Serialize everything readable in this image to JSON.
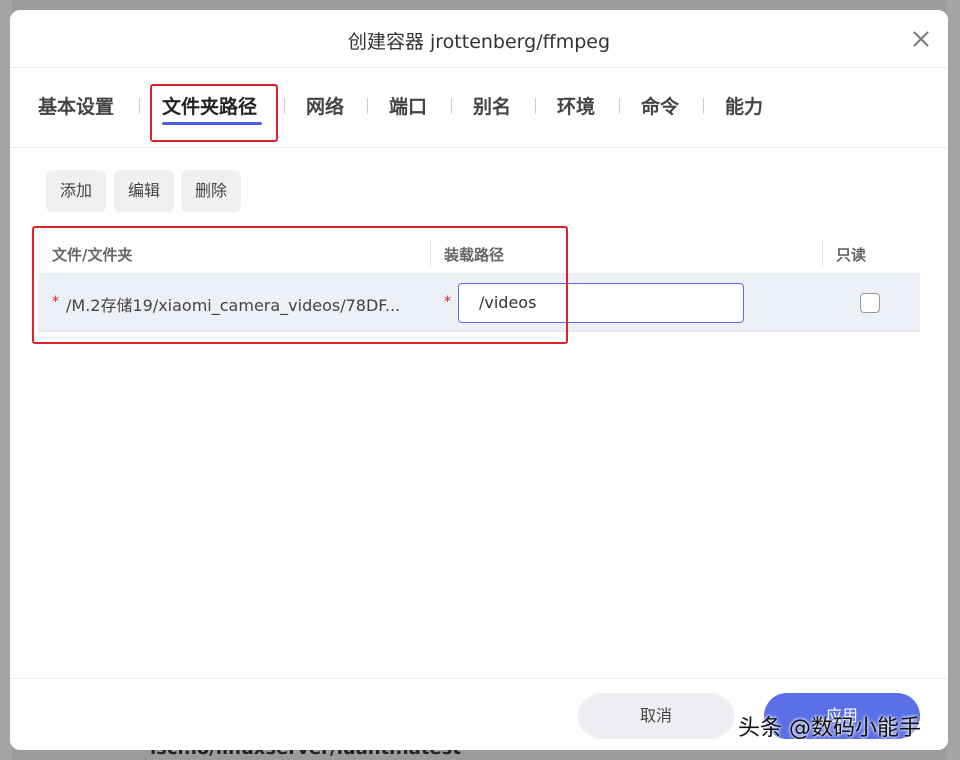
{
  "dialog": {
    "title": "创建容器 jrottenberg/ffmpeg"
  },
  "tabs": [
    {
      "label": "基本设置"
    },
    {
      "label": "文件夹路径",
      "active": true
    },
    {
      "label": "网络"
    },
    {
      "label": "端口"
    },
    {
      "label": "别名"
    },
    {
      "label": "环境"
    },
    {
      "label": "命令"
    },
    {
      "label": "能力"
    }
  ],
  "toolbar": {
    "add_label": "添加",
    "edit_label": "编辑",
    "delete_label": "删除"
  },
  "table": {
    "columns": [
      "文件/文件夹",
      "装载路径",
      "只读"
    ],
    "rows": [
      {
        "path": "/M.2存储19/xiaomi_camera_videos/78DF...",
        "mount": "/videos",
        "readonly": false
      }
    ]
  },
  "footer": {
    "cancel_label": "取消",
    "apply_label": "应用"
  },
  "watermark": "头条 @数码小能手",
  "background": {
    "bottom_text": "lscr.io/linuxserver/luanti:latest"
  },
  "colors": {
    "accent": "#5b6fe6",
    "highlight": "#e0202a",
    "required": "#e0202a"
  },
  "icons": {
    "close": "close-icon",
    "checkbox": "checkbox-unchecked"
  }
}
